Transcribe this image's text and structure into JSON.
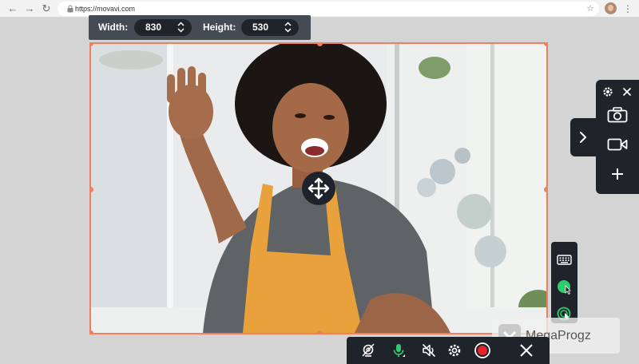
{
  "browser": {
    "back_icon": "arrow-left-icon",
    "forward_icon": "arrow-right-icon",
    "reload_icon": "reload-icon",
    "url": "https://movavi.com",
    "bookmark_icon": "star-icon",
    "menu_icon": "kebab-menu-icon"
  },
  "capture_size": {
    "width_label": "Width:",
    "width_value": "830",
    "height_label": "Height:",
    "height_value": "530"
  },
  "side_panel": {
    "settings_icon": "gear-icon",
    "close_icon": "close-icon",
    "screenshot_icon": "camera-icon",
    "record_icon": "video-camera-icon",
    "new_capture_icon": "plus-icon",
    "expand_icon": "chevron-right-icon"
  },
  "mini_toolbar": {
    "keyboard_icon": "keyboard-icon",
    "cursor_highlight_icon": "cursor-highlight-icon",
    "click_effect_icon": "click-effect-icon"
  },
  "bottom_toolbar": {
    "webcam_icon": "webcam-off-icon",
    "mic_icon": "microphone-icon",
    "system_audio_icon": "speaker-muted-icon",
    "settings_icon": "gear-icon",
    "record_icon": "record-button-icon",
    "close_icon": "close-icon"
  },
  "watermark": {
    "text": "MegaProgz"
  },
  "colors": {
    "selection_border": "#f07f5e",
    "panel_bg": "#1f232a",
    "accent_green": "#2ecc71",
    "record_red": "#e8212c"
  }
}
